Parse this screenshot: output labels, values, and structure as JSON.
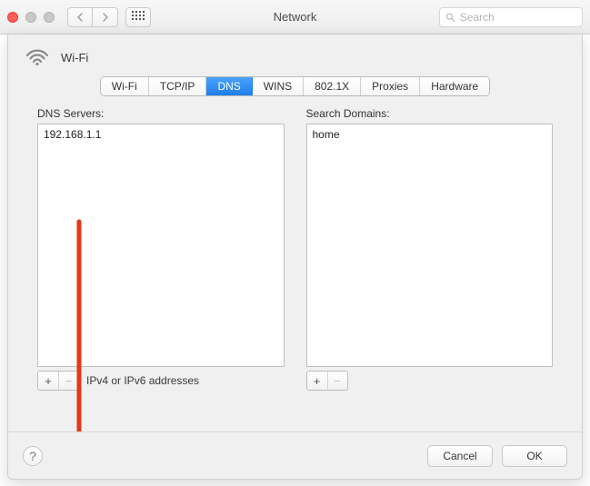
{
  "window": {
    "title": "Network",
    "search_placeholder": "Search"
  },
  "header": {
    "interface_name": "Wi-Fi"
  },
  "tabs": [
    {
      "label": "Wi-Fi",
      "active": false
    },
    {
      "label": "TCP/IP",
      "active": false
    },
    {
      "label": "DNS",
      "active": true
    },
    {
      "label": "WINS",
      "active": false
    },
    {
      "label": "802.1X",
      "active": false
    },
    {
      "label": "Proxies",
      "active": false
    },
    {
      "label": "Hardware",
      "active": false
    }
  ],
  "dns_panel": {
    "dns_servers": {
      "label": "DNS Servers:",
      "items": [
        "192.168.1.1"
      ],
      "footer_hint": "IPv4 or IPv6 addresses",
      "add_label": "+",
      "remove_label": "−"
    },
    "search_domains": {
      "label": "Search Domains:",
      "items": [
        "home"
      ],
      "add_label": "+",
      "remove_label": "−"
    }
  },
  "footer": {
    "help_label": "?",
    "cancel": "Cancel",
    "ok": "OK"
  }
}
